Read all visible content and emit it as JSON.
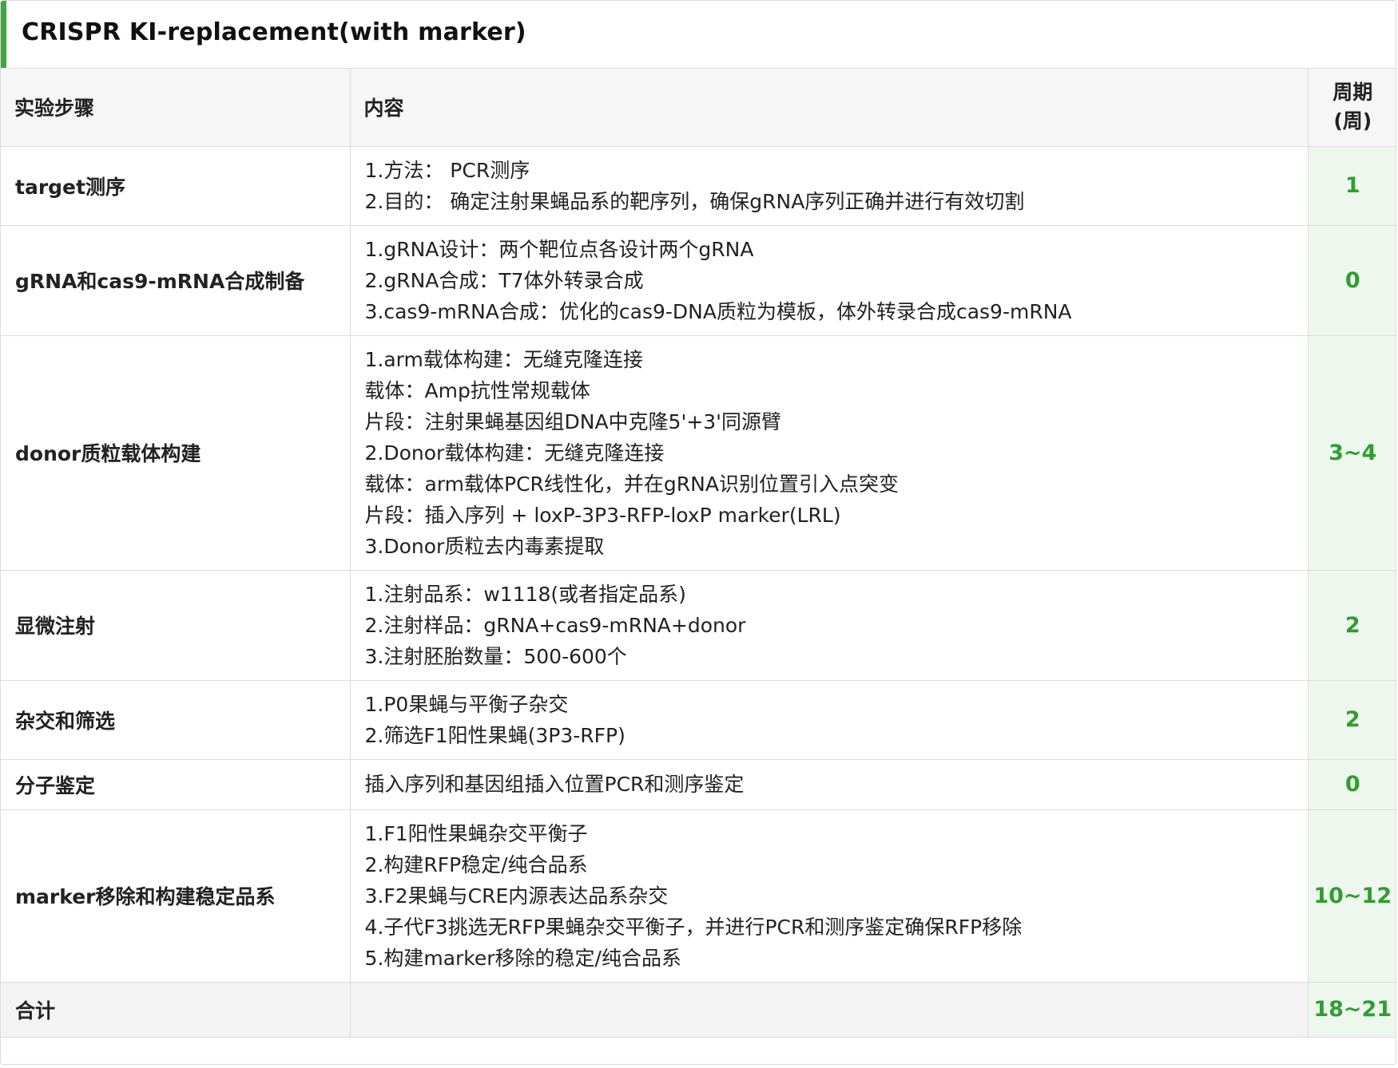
{
  "title": "CRISPR KI-replacement(with marker)",
  "table": {
    "headers": {
      "step": "实验步骤",
      "content": "内容",
      "cycle_line1": "周期",
      "cycle_line2": "(周)"
    },
    "rows": [
      {
        "step": "target测序",
        "content": [
          "1.方法： PCR测序",
          "2.目的： 确定注射果蝇品系的靶序列，确保gRNA序列正确并进行有效切割"
        ],
        "cycle": "1"
      },
      {
        "step": "gRNA和cas9-mRNA合成制备",
        "content": [
          "1.gRNA设计：两个靶位点各设计两个gRNA",
          "2.gRNA合成：T7体外转录合成",
          "3.cas9-mRNA合成：优化的cas9-DNA质粒为模板，体外转录合成cas9-mRNA"
        ],
        "cycle": "0"
      },
      {
        "step": "donor质粒载体构建",
        "content": [
          "1.arm载体构建：无缝克隆连接",
          "载体：Amp抗性常规载体",
          "片段：注射果蝇基因组DNA中克隆5'+3'同源臂",
          "2.Donor载体构建：无缝克隆连接",
          "载体：arm载体PCR线性化，并在gRNA识别位置引入点突变",
          "片段：插入序列 + loxP-3P3-RFP-loxP marker(LRL)",
          "3.Donor质粒去内毒素提取"
        ],
        "cycle": "3~4"
      },
      {
        "step": "显微注射",
        "content": [
          "1.注射品系：w1118(或者指定品系)",
          "2.注射样品：gRNA+cas9-mRNA+donor",
          "3.注射胚胎数量：500-600个"
        ],
        "cycle": "2"
      },
      {
        "step": "杂交和筛选",
        "content": [
          "1.P0果蝇与平衡子杂交",
          "2.筛选F1阳性果蝇(3P3-RFP)"
        ],
        "cycle": "2"
      },
      {
        "step": "分子鉴定",
        "content": [
          "插入序列和基因组插入位置PCR和测序鉴定"
        ],
        "cycle": "0"
      },
      {
        "step": "marker移除和构建稳定品系",
        "content": [
          "1.F1阳性果蝇杂交平衡子",
          "2.构建RFP稳定/纯合品系",
          "3.F2果蝇与CRE内源表达品系杂交",
          "4.子代F3挑选无RFP果蝇杂交平衡子，并进行PCR和测序鉴定确保RFP移除",
          "5.构建marker移除的稳定/纯合品系"
        ],
        "cycle": "10~12"
      }
    ],
    "total": {
      "label": "合计",
      "content": "",
      "cycle": "18~21"
    }
  },
  "colors": {
    "accent": "#3cab3c",
    "cycle_text": "#2f9e2f",
    "cycle_bg": "#eef7ee",
    "header_bg": "#f5f6f5"
  }
}
